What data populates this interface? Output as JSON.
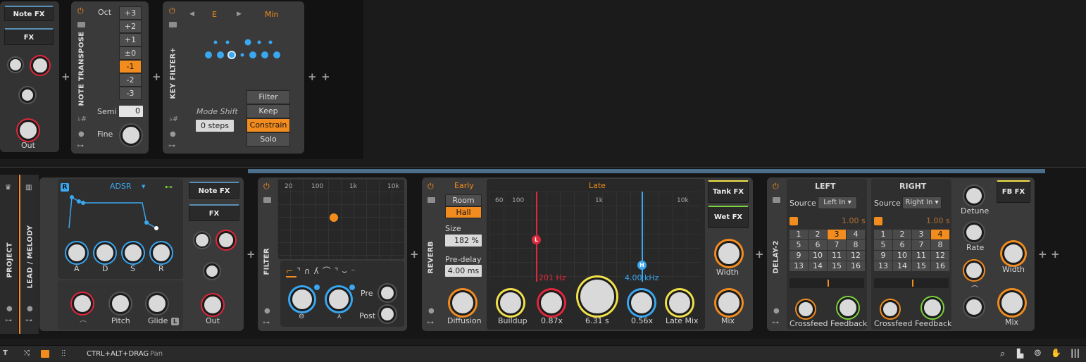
{
  "top": {
    "note_fx_label": "Note FX",
    "fx_label": "FX",
    "out_label": "Out",
    "note_transpose": {
      "title": "NOTE TRANSPOSE",
      "oct_label": "Oct",
      "oct_values": [
        "+3",
        "+2",
        "+1",
        "±0",
        "-1",
        "-2",
        "-3"
      ],
      "oct_selected": 4,
      "semi_label": "Semi",
      "semi_value": "0",
      "fine_label": "Fine"
    },
    "key_filter": {
      "title": "KEY FILTER+",
      "key": "E",
      "scale": "Min",
      "mode_shift_label": "Mode Shift",
      "mode_shift_value": "0 steps",
      "modes": [
        "Filter",
        "Keep",
        "Constrain",
        "Solo"
      ],
      "mode_selected": 2
    }
  },
  "chain": {
    "project_label": "PROJECT",
    "track_label": "LEAD / MELODY",
    "env": {
      "badge": "R",
      "type": "ADSR",
      "knobs": [
        "A",
        "D",
        "S",
        "R"
      ],
      "pitch_label": "Pitch",
      "glide_label": "Glide",
      "glide_badge": "L"
    },
    "inst_note_fx": "Note FX",
    "inst_fx": "FX",
    "inst_out": "Out",
    "filter": {
      "title": "FILTER",
      "freq_ticks": [
        "20",
        "100",
        "1k",
        "10k"
      ],
      "pre_label": "Pre",
      "post_label": "Post"
    },
    "reverb": {
      "title": "REVERB",
      "early_label": "Early",
      "room_label": "Room",
      "hall_label": "Hall",
      "size_label": "Size",
      "size_value": "182 %",
      "predelay_label": "Pre-delay",
      "predelay_value": "4.00 ms",
      "diffusion_label": "Diffusion",
      "late_label": "Late",
      "late_ticks": [
        "60",
        "100",
        "1k",
        "10k"
      ],
      "low_freq": "201 Hz",
      "high_freq": "4.00 kHz",
      "low_marker": "L",
      "high_marker": "H",
      "knobs": [
        "Buildup",
        "0.87x",
        "6.31 s",
        "0.56x",
        "Late Mix"
      ],
      "tank_fx": "Tank FX",
      "wet_fx": "Wet FX",
      "width_label": "Width",
      "mix_label": "Mix"
    },
    "delay": {
      "title": "DELAY-2",
      "left_label": "LEFT",
      "right_label": "RIGHT",
      "source_label": "Source",
      "left_source": "Left In",
      "right_source": "Right In",
      "left_time": "1.00 s",
      "right_time": "1.00 s",
      "grid": [
        "1",
        "2",
        "3",
        "4",
        "5",
        "6",
        "7",
        "8",
        "9",
        "10",
        "11",
        "12",
        "13",
        "14",
        "15",
        "16"
      ],
      "left_selected": 2,
      "right_selected": 3,
      "crossfeed_label": "Crossfeed",
      "feedback_label": "Feedback",
      "detune_label": "Detune",
      "rate_label": "Rate",
      "fb_fx": "FB FX",
      "width_label": "Width",
      "mix_label": "Mix"
    }
  },
  "status": {
    "shortcut": "CTRL+ALT+DRAG",
    "action": "Pan"
  },
  "colors": {
    "accent": "#f28c1f",
    "blue": "#3aa7f0",
    "red": "#e0283c",
    "yellow": "#f2e14a",
    "green": "#7cd33c"
  }
}
